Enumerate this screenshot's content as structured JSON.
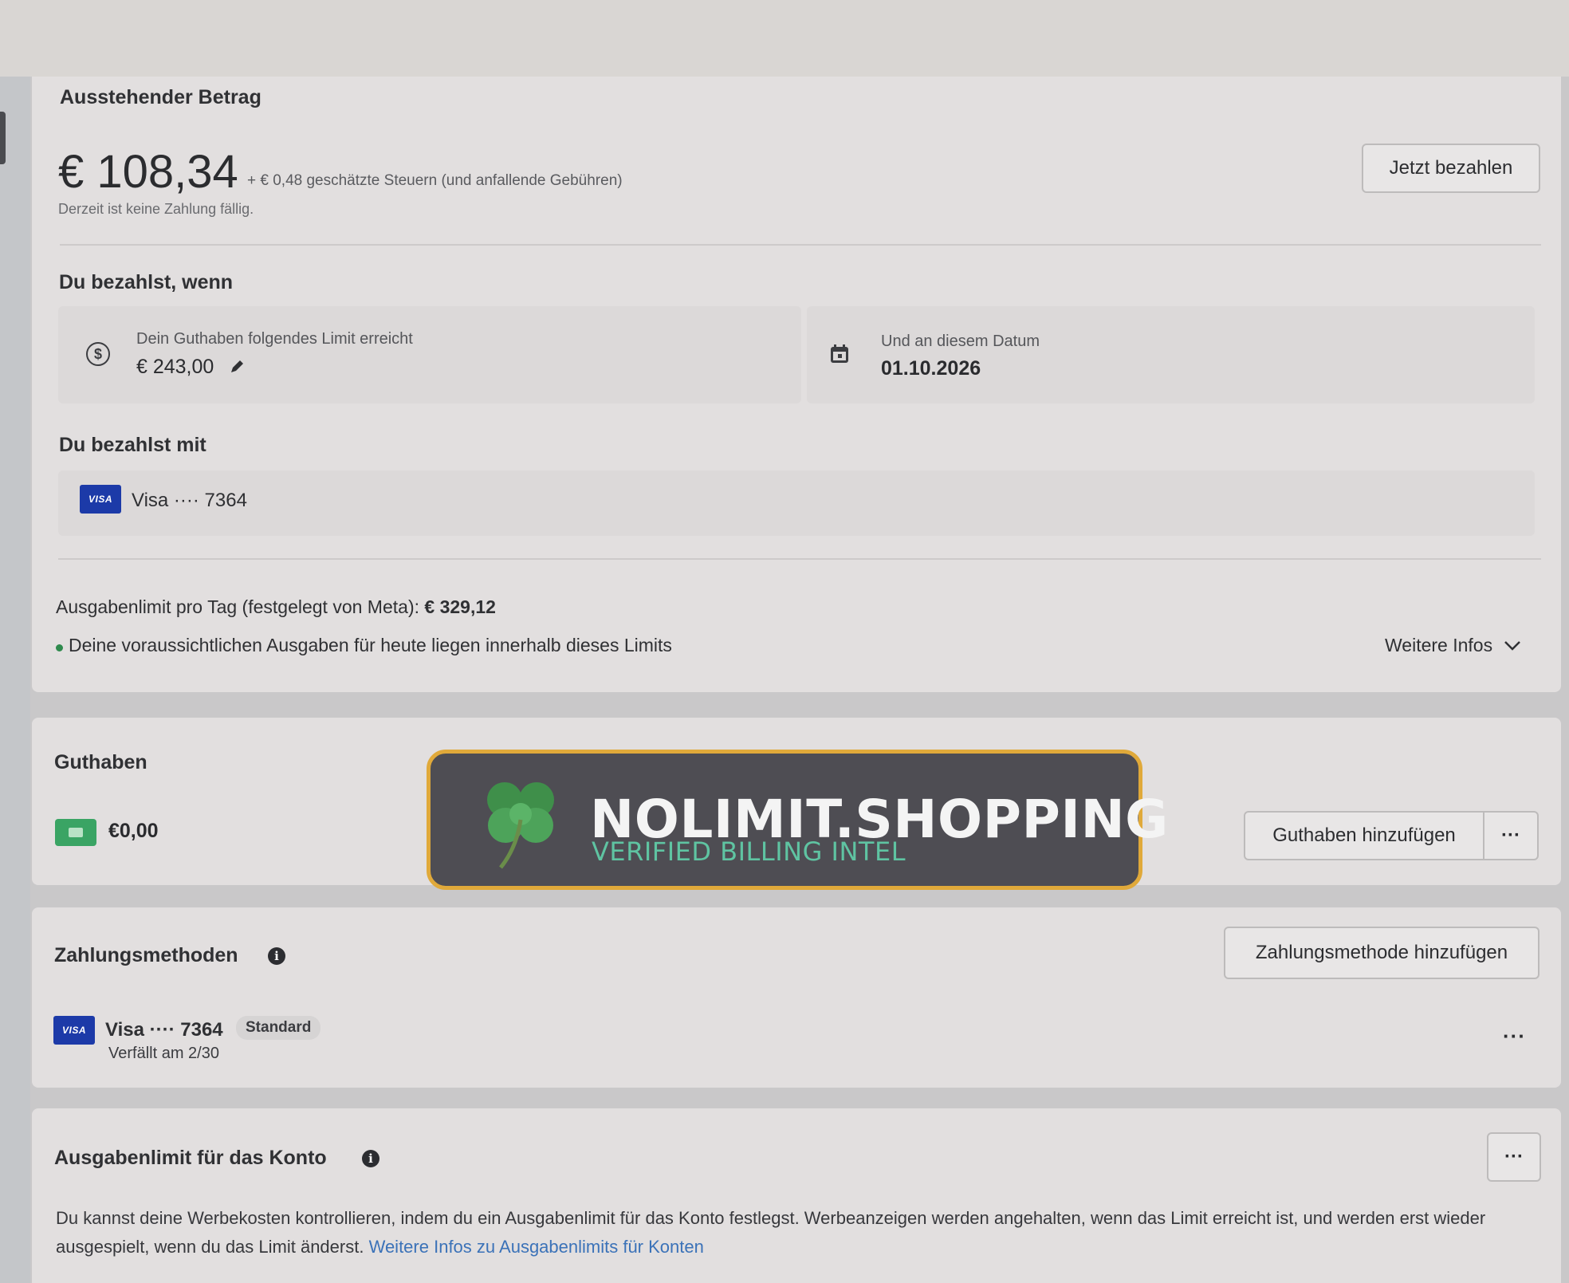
{
  "outstanding": {
    "heading": "Ausstehender Betrag",
    "amount": "€ 108,34",
    "tax_note": "+ € 0,48 geschätzte Steuern (und anfallende Gebühren)",
    "due_note": "Derzeit ist keine Zahlung fällig.",
    "pay_now_label": "Jetzt bezahlen"
  },
  "pay_when": {
    "heading": "Du bezahlst, wenn",
    "threshold_label": "Dein Guthaben folgendes Limit erreicht",
    "threshold_value": "€ 243,00",
    "date_label": "Und an diesem Datum",
    "date_value": "01.10.2026"
  },
  "pay_with": {
    "heading": "Du bezahlst mit",
    "card_brand": "VISA",
    "card_text": "Visa ···· 7364"
  },
  "daily_limit": {
    "label": "Ausgabenlimit pro Tag (festgelegt von Meta):",
    "value": "€ 329,12",
    "forecast": "Deine voraussichtlichen Ausgaben für heute liegen innerhalb dieses Limits",
    "more_infos": "Weitere Infos"
  },
  "balance": {
    "heading": "Guthaben",
    "value": "€0,00",
    "add_label": "Guthaben hinzufügen",
    "more": "···"
  },
  "payment_methods": {
    "heading": "Zahlungsmethoden",
    "add_label": "Zahlungsmethode hinzufügen",
    "card_brand": "VISA",
    "card_text": "Visa ···· 7364",
    "badge": "Standard",
    "expiry": "Verfällt am 2/30",
    "more": "···"
  },
  "account_limit": {
    "heading": "Ausgabenlimit für das Konto",
    "more": "···",
    "paragraph": "Du kannst deine Werbekosten kontrollieren, indem du ein Ausgabenlimit für das Konto festlegst. Werbeanzeigen werden angehalten, wenn das Limit erreicht ist, und werden erst wieder ausgespielt, wenn du das Limit änderst.",
    "link": "Weitere Infos zu Ausgabenlimits für Konten"
  },
  "watermark": {
    "title": "NOLIMIT.SHOPPING",
    "subtitle": "VERIFIED BILLING INTEL"
  },
  "colors": {
    "accent_link": "#3b72b8",
    "visa_blue": "#1c3aa8",
    "wallet_green": "#3aa464",
    "banner_border": "#e0a93a",
    "banner_sub": "#5fc4a2"
  },
  "icons": [
    "dollar-circle-icon",
    "pencil-icon",
    "calendar-icon",
    "info-icon",
    "chevron-down-icon",
    "wallet-icon",
    "clover-icon",
    "more-icon"
  ]
}
